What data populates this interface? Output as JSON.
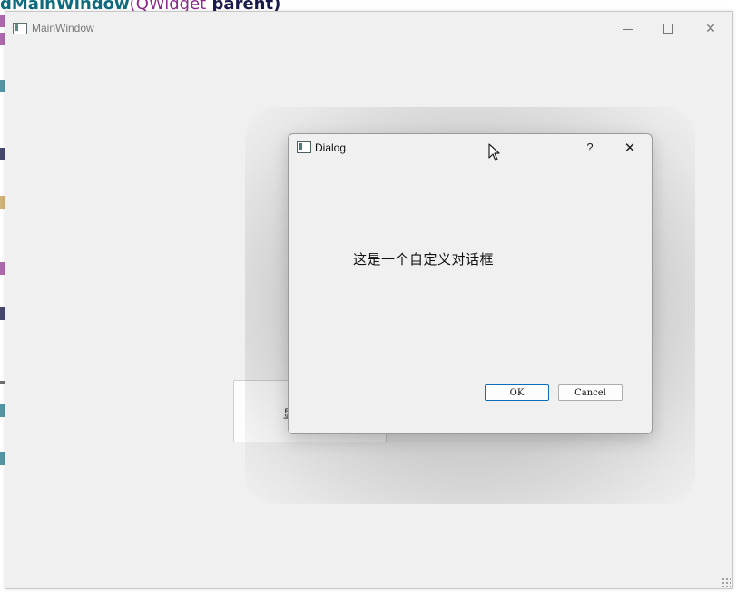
{
  "background_code": {
    "top_line": {
      "name": "dMainWindow",
      "open_paren": "(",
      "type": "QWidget",
      "param": "parent",
      "close": ")"
    },
    "colors": {
      "teal": "#0e6a7d",
      "purple": "#8a2a8a",
      "navy": "#1a1a4a"
    }
  },
  "main_window": {
    "title": "MainWindow",
    "icon": "app-window-icon",
    "controls": {
      "minimize_icon": "minimize-icon",
      "maximize_icon": "maximize-icon",
      "close_icon": "close-icon",
      "close_glyph": "✕"
    },
    "background_button_label": "显"
  },
  "dialog": {
    "title": "Dialog",
    "icon": "app-window-icon",
    "help_label": "?",
    "close_glyph": "✕",
    "message": "这是一个自定义对话框",
    "ok_label": "OK",
    "cancel_label": "Cancel",
    "accent_color": "#0f6cbd"
  }
}
